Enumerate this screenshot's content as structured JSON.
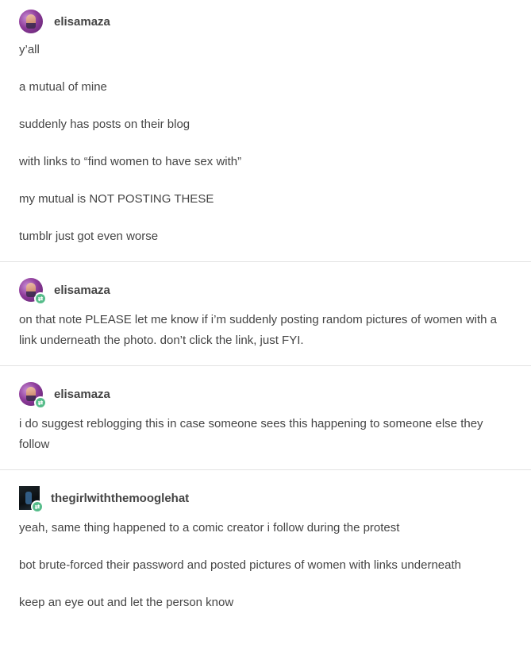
{
  "posts": [
    {
      "username": "elisamaza",
      "avatar_icon": "user-avatar-purple",
      "reblog": false,
      "paragraphs": [
        "y’all",
        "a mutual of mine",
        "suddenly has posts on their blog",
        "with links to “find women to have sex with”",
        "my mutual is NOT POSTING THESE",
        "tumblr just got even worse"
      ]
    },
    {
      "username": "elisamaza",
      "avatar_icon": "user-avatar-purple",
      "reblog": true,
      "paragraphs": [
        "on that note PLEASE let me know if i’m suddenly posting random pictures of women with a link underneath the photo. don’t click the link, just FYI."
      ]
    },
    {
      "username": "elisamaza",
      "avatar_icon": "user-avatar-purple",
      "reblog": true,
      "paragraphs": [
        "i do suggest reblogging this in case someone sees this happening to someone else they follow"
      ]
    },
    {
      "username": "thegirlwiththemooglehat",
      "avatar_icon": "user-avatar-dark",
      "reblog": true,
      "paragraphs": [
        "yeah, same thing happened to a comic creator i follow during the protest",
        "bot brute-forced their password and posted pictures of women with links underneath",
        "keep an eye out and let the person know"
      ]
    }
  ],
  "colors": {
    "text": "#444444",
    "divider": "#e3e3e3",
    "reblog_badge": "#56bc8a"
  }
}
